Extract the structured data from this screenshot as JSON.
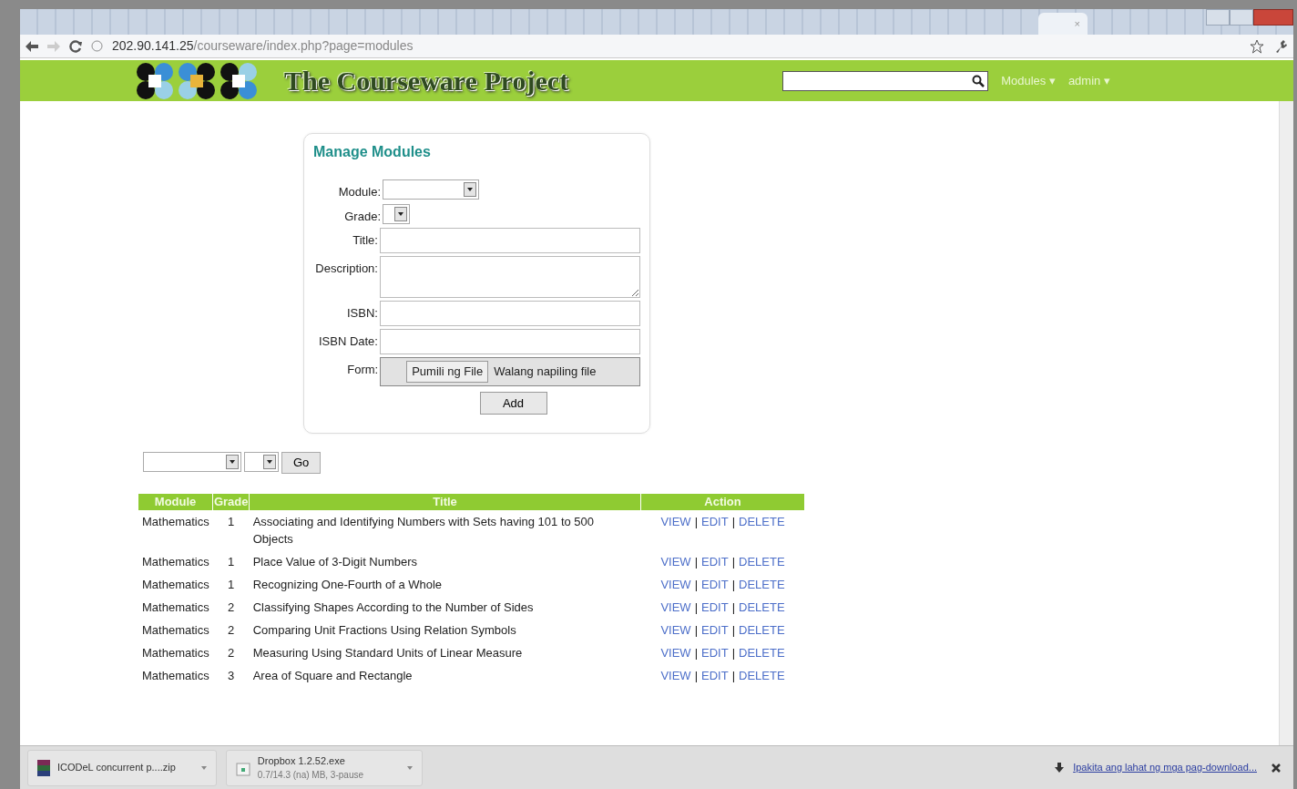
{
  "browser": {
    "tab_close": "×",
    "address": {
      "host": "202.90.141.25",
      "path": "/courseware/index.php?page=modules"
    }
  },
  "header": {
    "site_title": "The Courseware Project",
    "menus": [
      "Modules ▾",
      "admin ▾"
    ]
  },
  "form": {
    "title": "Manage Modules",
    "fields": [
      {
        "label": "Module:",
        "kind": "select"
      },
      {
        "label": "Grade:",
        "kind": "select"
      },
      {
        "label": "Title:",
        "kind": "input"
      },
      {
        "label": "Description:",
        "kind": "textarea"
      },
      {
        "label": "ISBN:",
        "kind": "input"
      },
      {
        "label": "ISBN Date:",
        "kind": "input"
      },
      {
        "label": "Form:",
        "kind": "file",
        "button": "Pumili ng File",
        "status": "Walang napiling file"
      }
    ],
    "submit": "Add"
  },
  "filter": {
    "go": "Go"
  },
  "table": {
    "columns": [
      "Module",
      "Grade",
      "Title",
      "Action"
    ],
    "rows": [
      {
        "module": "Mathematics",
        "grade": "1",
        "title": "Associating and Identifying Numbers with Sets having 101 to 500 Objects",
        "actions": [
          "VIEW",
          "|",
          "EDIT",
          "|",
          "DELETE"
        ]
      },
      {
        "module": "Mathematics",
        "grade": "1",
        "title": "Place Value of 3-Digit Numbers",
        "actions": [
          "VIEW",
          "|",
          "EDIT",
          "|",
          "DELETE"
        ]
      },
      {
        "module": "Mathematics",
        "grade": "1",
        "title": "Recognizing One-Fourth of a Whole",
        "actions": [
          "VIEW",
          "|",
          "EDIT",
          "|",
          "DELETE"
        ]
      },
      {
        "module": "Mathematics",
        "grade": "2",
        "title": "Classifying Shapes According to the Number of Sides",
        "actions": [
          "VIEW",
          "|",
          "EDIT",
          "|",
          "DELETE"
        ]
      },
      {
        "module": "Mathematics",
        "grade": "2",
        "title": "Comparing Unit Fractions Using Relation Symbols",
        "actions": [
          "VIEW",
          "|",
          "EDIT",
          "|",
          "DELETE"
        ]
      },
      {
        "module": "Mathematics",
        "grade": "2",
        "title": "Measuring Using Standard Units of Linear Measure",
        "actions": [
          "VIEW",
          "|",
          "EDIT",
          "|",
          "DELETE"
        ]
      },
      {
        "module": "Mathematics",
        "grade": "3",
        "title": "Area of Square and Rectangle",
        "actions": [
          "VIEW",
          "|",
          "EDIT",
          "|",
          "DELETE"
        ]
      }
    ]
  },
  "downloads": {
    "items": [
      {
        "kind": "archive",
        "name": "ICODeL concurrent p....zip"
      },
      {
        "kind": "exe",
        "name": "Dropbox 1.2.52.exe",
        "status": "0.7/14.3 (na) MB, 3-pause"
      }
    ],
    "show_all": "Ipakita ang lahat ng mga pag-download..."
  }
}
